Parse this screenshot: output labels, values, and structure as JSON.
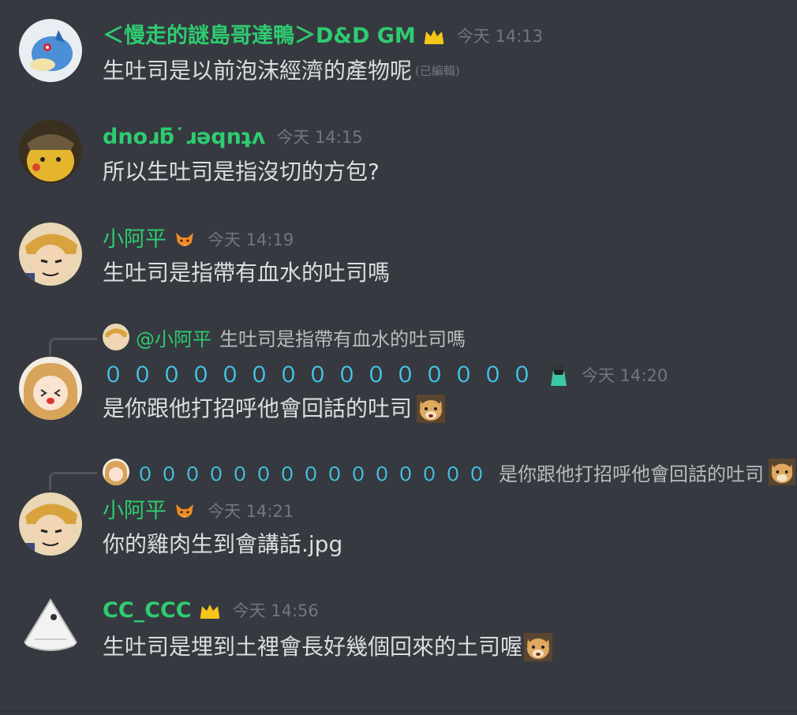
{
  "messages": [
    {
      "author": "＜慢走的謎島哥達鴨＞D&D GM",
      "author_color": "#2ecc71",
      "badge": "crown-icon",
      "timestamp": "今天 14:13",
      "text": "生吐司是以前泡沫經濟的產物呢",
      "edited": "(已編輯)",
      "avatar": "golduck-avatar"
    },
    {
      "author": "dnoɹƃ˙ɹəqnʇʌ",
      "author_color": "#2ecc71",
      "timestamp": "今天 14:15",
      "text": "所以生吐司是指沒切的方包?",
      "avatar": "detective-pikachu-avatar"
    },
    {
      "author": "小阿平",
      "author_color": "#2ecc71",
      "badge": "fox-icon",
      "timestamp": "今天 14:19",
      "text": "生吐司是指帶有血水的吐司嗎",
      "avatar": "anime-guy-avatar"
    },
    {
      "reply_to": {
        "author": "@小阿平",
        "text": "生吐司是指帶有血水的吐司嗎"
      },
      "author": "０００００００００００００００",
      "author_color": "#43c6e8",
      "badge": "dress-icon",
      "timestamp": "今天 14:20",
      "text": "是你跟他打招呼他會回話的吐司",
      "emoji": "shiba-emoji",
      "avatar": "anime-girl-avatar"
    },
    {
      "reply_to": {
        "author": "０００００００００００００００",
        "text": "是你跟他打招呼他會回話的吐司"
      },
      "author": "小阿平",
      "author_color": "#2ecc71",
      "badge": "fox-icon",
      "timestamp": "今天 14:21",
      "text": "你的雞肉生到會講話.jpg",
      "avatar": "anime-guy-avatar"
    },
    {
      "author": "CC_CCC",
      "author_color": "#2ecc71",
      "badge": "crown-icon",
      "timestamp": "今天 14:56",
      "text": "生吐司是埋到土裡會長好幾個回來的土司喔",
      "emoji": "shiba-emoji",
      "avatar": "white-fish-avatar"
    }
  ]
}
